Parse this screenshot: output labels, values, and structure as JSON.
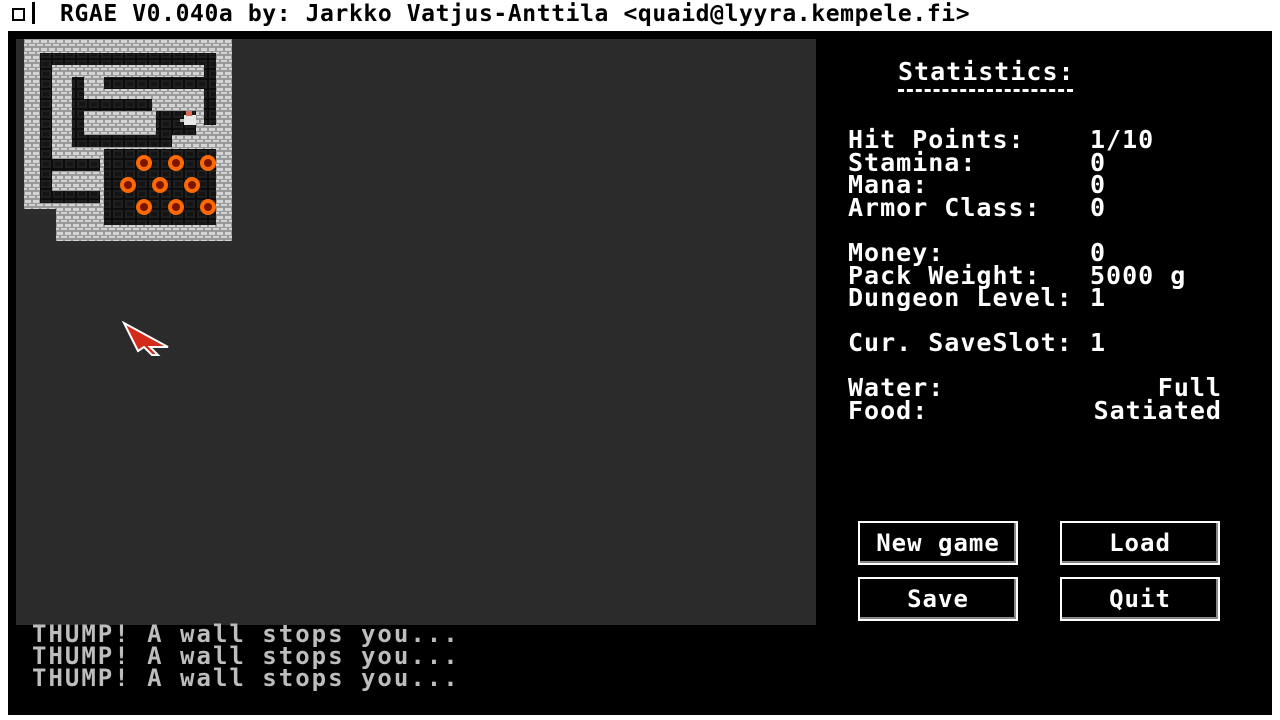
{
  "title_bar": {
    "text": "RGAE V0.040a by: Jarkko Vatjus-Anttila <quaid@lyyra.kempele.fi>"
  },
  "stats": {
    "heading": "Statistics:",
    "hit_points": {
      "label": "Hit Points:",
      "value": "1/10"
    },
    "stamina": {
      "label": "Stamina:",
      "value": "0"
    },
    "mana": {
      "label": "Mana:",
      "value": "0"
    },
    "armor_class": {
      "label": "Armor Class:",
      "value": "0"
    },
    "money": {
      "label": "Money:",
      "value": "0"
    },
    "pack_weight": {
      "label": "Pack Weight:",
      "value": "5000 g"
    },
    "dungeon_level": {
      "label": "Dungeon Level:",
      "value": "1"
    },
    "save_slot": {
      "label": "Cur. SaveSlot:",
      "value": "1"
    },
    "water": {
      "label": "Water:",
      "value": "Full"
    },
    "food": {
      "label": "Food:",
      "value": "Satiated"
    }
  },
  "buttons": {
    "new_game": "New game",
    "load": "Load",
    "save": "Save",
    "quit": "Quit"
  },
  "message_log": [
    "THUMP! A wall stops you...",
    "THUMP! A wall stops you...",
    "THUMP! A wall stops you..."
  ],
  "colors": {
    "map_background": "#2b2b2b",
    "wall": "#c8c8c8",
    "floor": "#141414",
    "fire": "#ff6a00",
    "log_text": "#bdbdbd"
  },
  "icons": {
    "player": "adventurer-icon",
    "hazard": "fire-icon",
    "cursor": "mouse-pointer-icon"
  }
}
